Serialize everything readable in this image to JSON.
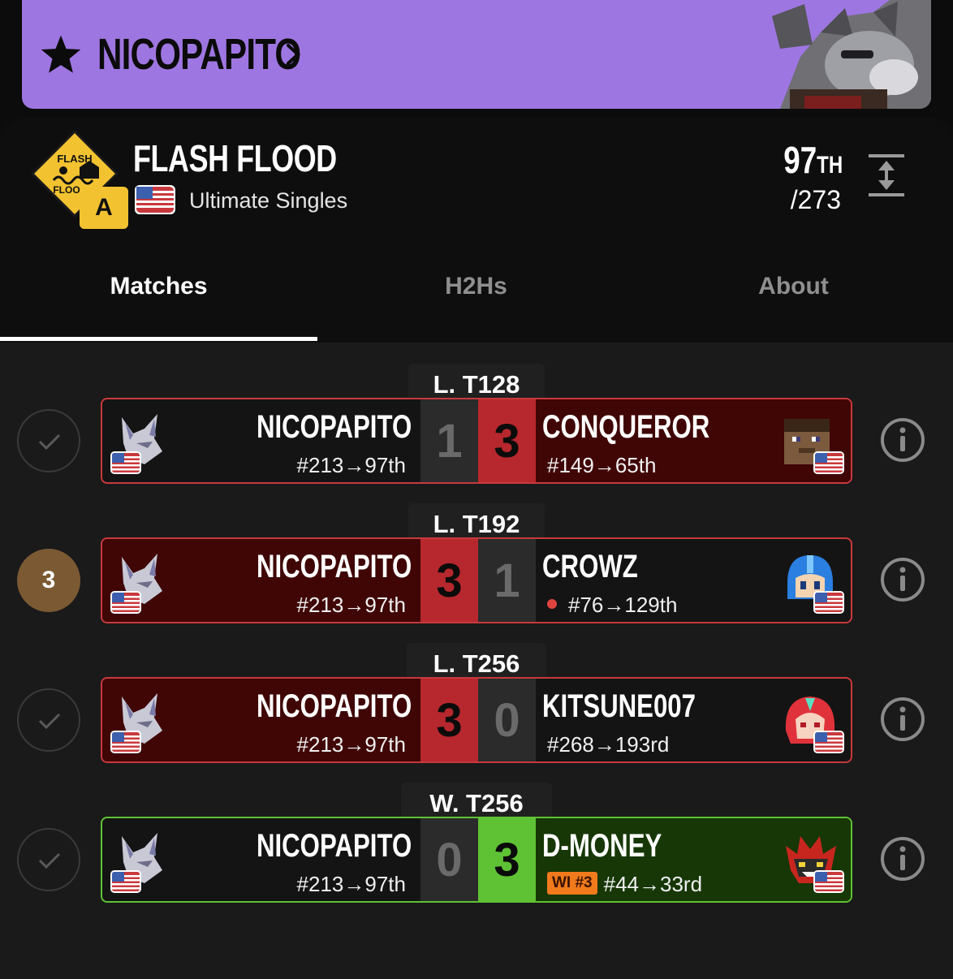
{
  "banner": {
    "player_name": "NICOPAPITO",
    "star_icon": "star-icon",
    "chevron_icon": "chevron-right-icon",
    "color": "#9e76e1"
  },
  "tournament": {
    "name": "FLASH FLOOD",
    "logo_text_top": "FLASH",
    "logo_text_bottom": "FLOOD",
    "tier": "A",
    "game": "Ultimate Singles",
    "country": "US",
    "placement": "97",
    "placement_suffix": "TH",
    "entrants": "/273"
  },
  "tabs": [
    {
      "label": "Matches",
      "active": true
    },
    {
      "label": "H2Hs",
      "active": false
    },
    {
      "label": "About",
      "active": false
    }
  ],
  "matches": [
    {
      "round": "L. T128",
      "status": "check",
      "player": {
        "name": "NICOPAPITO",
        "seed": "#213→97th",
        "character": "wolf-icon"
      },
      "opponent": {
        "name": "CONQUEROR",
        "seed": "#149→65th",
        "character": "steve-icon"
      },
      "score": [
        1,
        3
      ],
      "result": "loss"
    },
    {
      "round": "L. T192",
      "status": "3",
      "player": {
        "name": "NICOPAPITO",
        "seed": "#213→97th",
        "character": "wolf-icon"
      },
      "opponent": {
        "name": "CROWZ",
        "seed": "#76→129th",
        "character": "mega-man-icon",
        "upset_dot": true
      },
      "score": [
        3,
        1
      ],
      "result": "win"
    },
    {
      "round": "L. T256",
      "status": "check",
      "player": {
        "name": "NICOPAPITO",
        "seed": "#213→97th",
        "character": "wolf-icon"
      },
      "opponent": {
        "name": "KITSUNE007",
        "seed": "#268→193rd",
        "character": "pyra-icon"
      },
      "score": [
        3,
        0
      ],
      "result": "win"
    },
    {
      "round": "W. T256",
      "status": "check",
      "player": {
        "name": "NICOPAPITO",
        "seed": "#213→97th",
        "character": "wolf-icon"
      },
      "opponent": {
        "name": "D-MONEY",
        "seed": "#44→33rd",
        "character": "incineroar-icon",
        "region_badge": "WI #3"
      },
      "score": [
        0,
        3
      ],
      "result": "loss-green"
    }
  ],
  "colors": {
    "loss_red": "#b6282d",
    "win_green": "#5fc234",
    "tier_yellow": "#f2c230"
  }
}
